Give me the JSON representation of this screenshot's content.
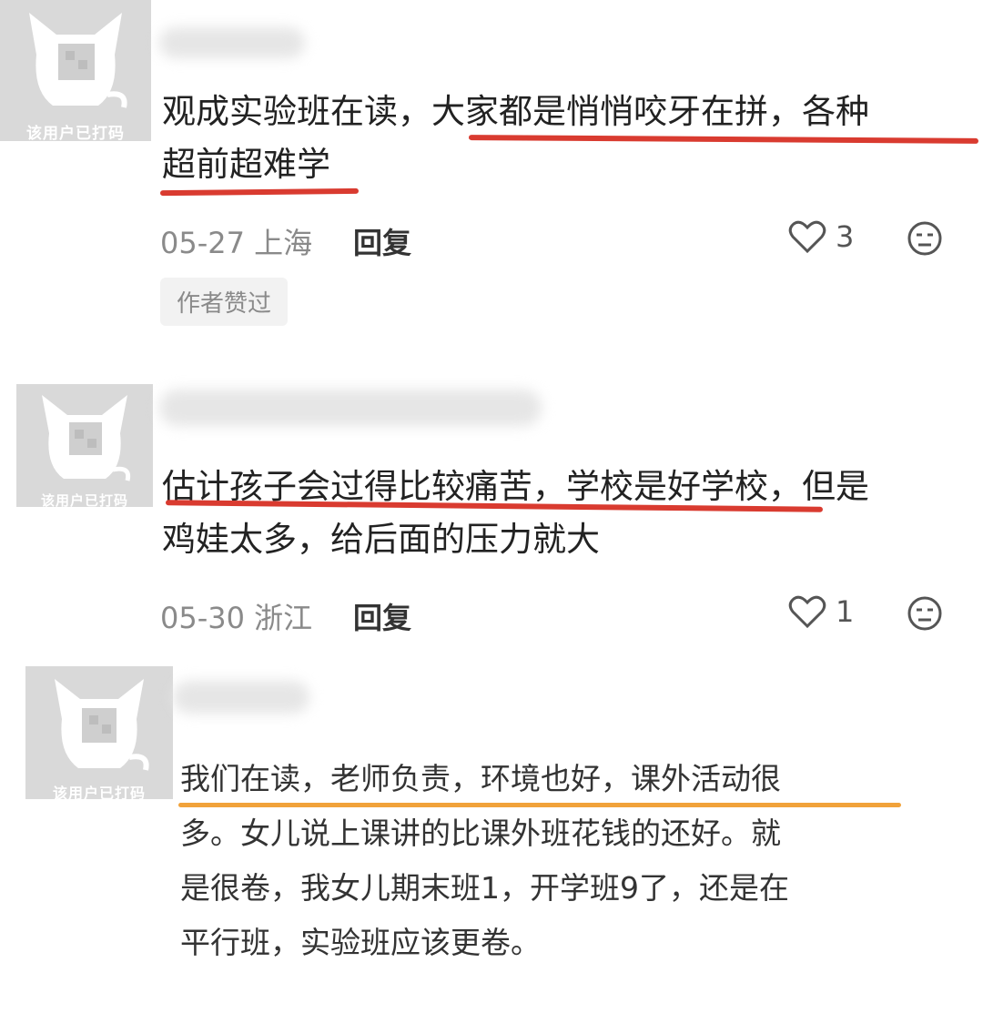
{
  "avatar_label": "该用户已打码",
  "reply_label": "回复",
  "comments": [
    {
      "lines": [
        "观成实验班在读，大家都是悄悄咬牙在拼，各种",
        "超前超难学"
      ],
      "date": "05-27",
      "location": "上海",
      "likes": "3",
      "tag": "作者赞过"
    },
    {
      "lines": [
        "估计孩子会过得比较痛苦，学校是好学校，但是",
        "鸡娃太多，给后面的压力就大"
      ],
      "date": "05-30",
      "location": "浙江",
      "likes": "1"
    },
    {
      "lines": [
        "我们在读，老师负责，环境也好，课外活动很",
        "多。女儿说上课讲的比课外班花钱的还好。就",
        "是很卷，我女儿期末班1，开学班9了，还是在",
        "平行班，实验班应该更卷。"
      ]
    }
  ],
  "colors": {
    "underline_red": "#d93b30",
    "underline_orange": "#f1a23a",
    "avatar_bg": "#d9d9d9"
  },
  "icons": [
    "cat-avatar-icon",
    "heart-icon",
    "emoji-face-icon"
  ]
}
